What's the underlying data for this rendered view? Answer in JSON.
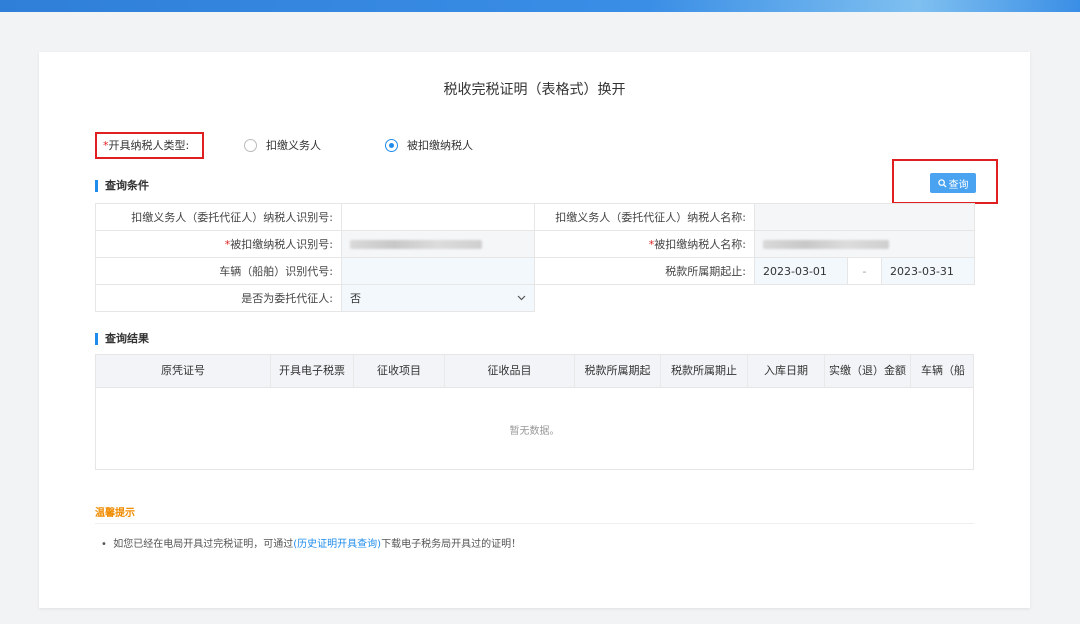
{
  "page": {
    "title": "税收完税证明（表格式）换开"
  },
  "taxpayer_type": {
    "required_mark": "*",
    "label": "开具纳税人类型:",
    "options": [
      {
        "label": "扣缴义务人",
        "selected": false
      },
      {
        "label": "被扣缴纳税人",
        "selected": true
      }
    ]
  },
  "query_conditions": {
    "title": "查询条件",
    "query_button": "查询",
    "fields": {
      "agent_id_label": "扣缴义务人（委托代征人）纳税人识别号:",
      "agent_name_label": "扣缴义务人（委托代征人）纳税人名称:",
      "payer_id_label": "被扣缴纳税人识别号:",
      "payer_name_label": "被扣缴纳税人名称:",
      "vehicle_id_label": "车辆（船舶）识别代号:",
      "period_label": "税款所属期起止:",
      "period_start": "2023-03-01",
      "period_sep": "-",
      "period_end": "2023-03-31",
      "is_agent_label": "是否为委托代征人:",
      "is_agent_value": "否"
    }
  },
  "query_results": {
    "title": "查询结果",
    "columns": [
      "原凭证号",
      "开具电子税票",
      "征收项目",
      "征收品目",
      "税款所属期起",
      "税款所属期止",
      "入库日期",
      "实缴（退）金额",
      "车辆（船"
    ],
    "empty_text": "暂无数据。"
  },
  "tips": {
    "title": "温馨提示",
    "bullet": "•",
    "text_before": "如您已经在电局开具过完税证明，可通过",
    "link": "(历史证明开具查询)",
    "text_after": "下载电子税务局开具过的证明！"
  }
}
